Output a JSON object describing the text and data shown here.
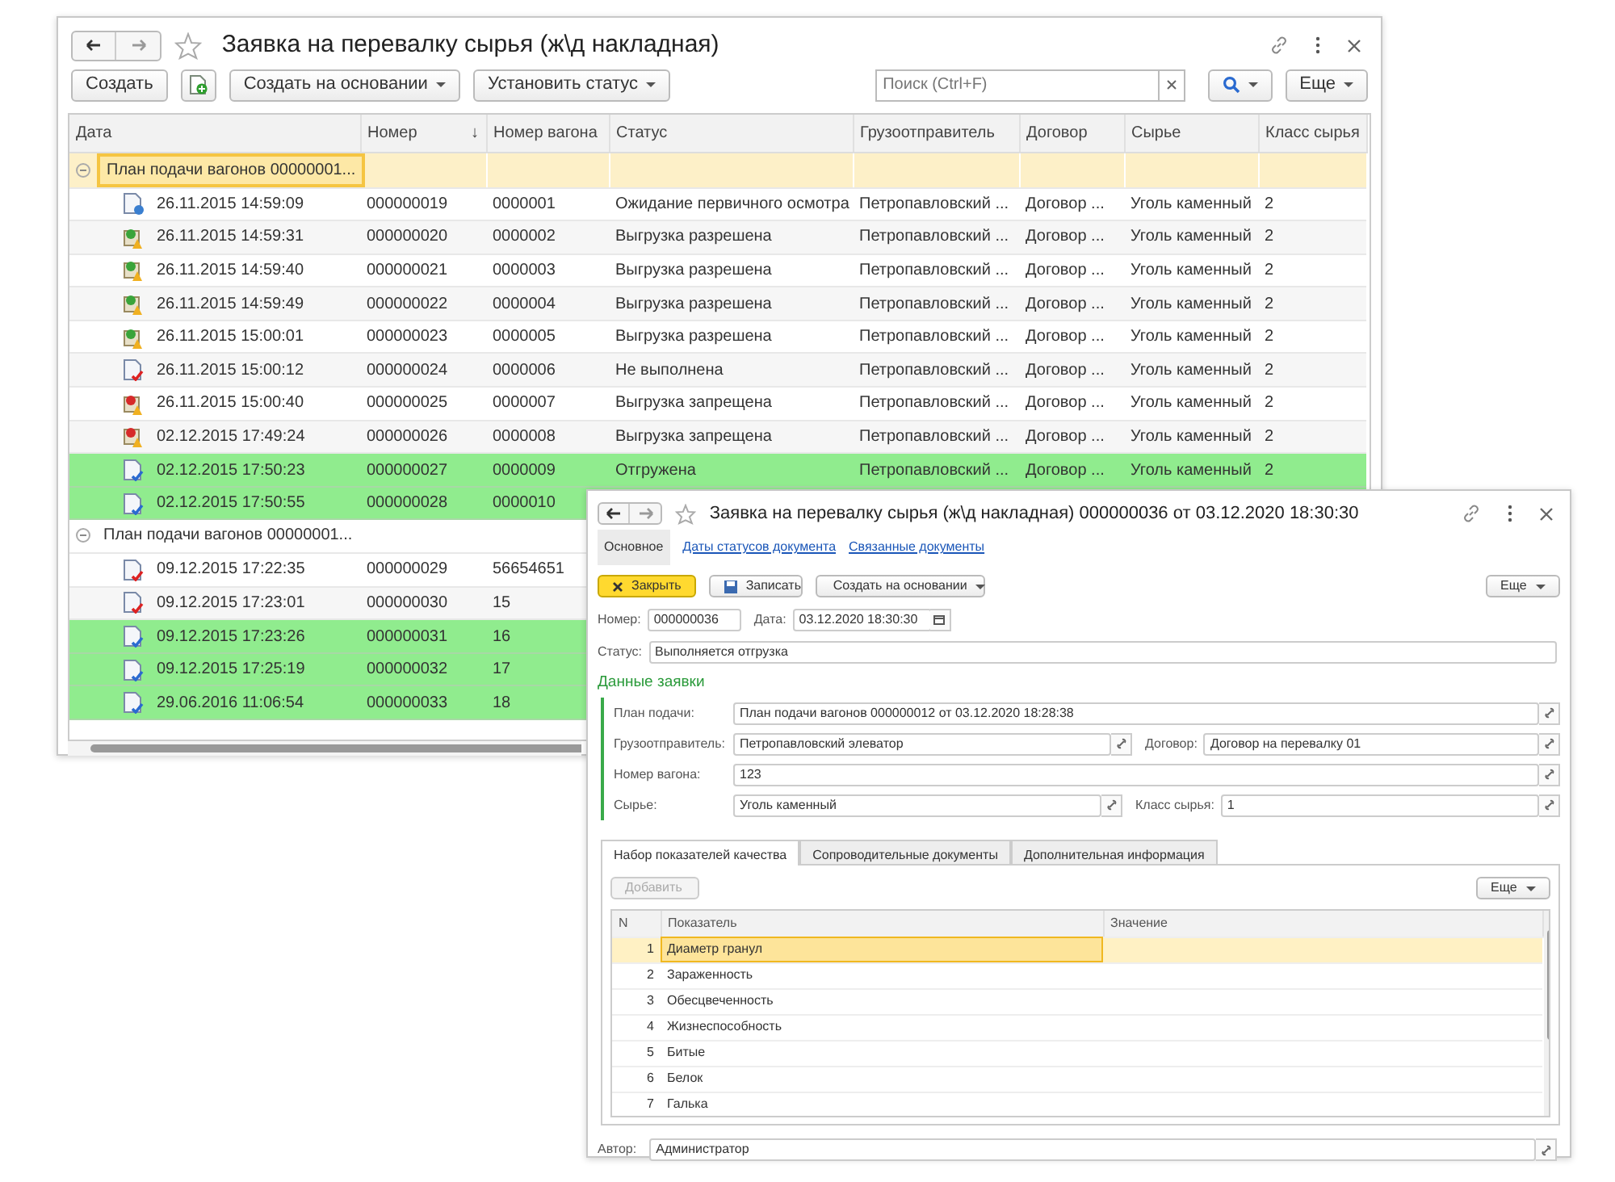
{
  "back_window": {
    "title": "Заявка на перевалку сырья (ж\\д накладная)",
    "buttons": [
      {
        "kind": "plain",
        "label": "Создать"
      },
      {
        "kind": "icon"
      },
      {
        "kind": "dropdown",
        "label": "Создать на основании"
      },
      {
        "kind": "dropdown",
        "label": "Установить статус"
      }
    ],
    "search": {
      "placeholder": "Поиск (Ctrl+F)"
    },
    "more_button": "Еще",
    "columns": [
      {
        "label": "Дата"
      },
      {
        "label": "Номер",
        "sort_arrow": "↓"
      },
      {
        "label": "Номер вагона"
      },
      {
        "label": "Статус"
      },
      {
        "label": "Грузоотправитель"
      },
      {
        "label": "Договор"
      },
      {
        "label": "Сырье"
      },
      {
        "label": "Класс сырья"
      }
    ],
    "groups": [
      {
        "label": "План подачи вагонов 00000001...",
        "selected": true,
        "expanded": true,
        "rows": [
          {
            "kind": "pending",
            "highlight": false,
            "cells": [
              "26.11.2015 14:59:09",
              "000000019",
              "0000001",
              "Ожидание первичного осмотра",
              "Петропавловский ...",
              "Договор ...",
              "Уголь каменный",
              "2"
            ]
          },
          {
            "kind": "allowed",
            "highlight": false,
            "cells": [
              "26.11.2015 14:59:31",
              "000000020",
              "0000002",
              "Выгрузка разрешена",
              "Петропавловский ...",
              "Договор ...",
              "Уголь каменный",
              "2"
            ]
          },
          {
            "kind": "allowed",
            "highlight": false,
            "cells": [
              "26.11.2015 14:59:40",
              "000000021",
              "0000003",
              "Выгрузка разрешена",
              "Петропавловский ...",
              "Договор ...",
              "Уголь каменный",
              "2"
            ]
          },
          {
            "kind": "allowed",
            "highlight": false,
            "cells": [
              "26.11.2015 14:59:49",
              "000000022",
              "0000004",
              "Выгрузка разрешена",
              "Петропавловский ...",
              "Договор ...",
              "Уголь каменный",
              "2"
            ]
          },
          {
            "kind": "allowed",
            "highlight": false,
            "cells": [
              "26.11.2015 15:00:01",
              "000000023",
              "0000005",
              "Выгрузка разрешена",
              "Петропавловский ...",
              "Договор ...",
              "Уголь каменный",
              "2"
            ]
          },
          {
            "kind": "not_done",
            "highlight": false,
            "cells": [
              "26.11.2015 15:00:12",
              "000000024",
              "0000006",
              "Не выполнена",
              "Петропавловский ...",
              "Договор ...",
              "Уголь каменный",
              "2"
            ]
          },
          {
            "kind": "forbidden",
            "highlight": false,
            "cells": [
              "26.11.2015 15:00:40",
              "000000025",
              "0000007",
              "Выгрузка запрещена",
              "Петропавловский ...",
              "Договор ...",
              "Уголь каменный",
              "2"
            ]
          },
          {
            "kind": "forbidden",
            "highlight": false,
            "cells": [
              "02.12.2015 17:49:24",
              "000000026",
              "0000008",
              "Выгрузка запрещена",
              "Петропавловский ...",
              "Договор ...",
              "Уголь каменный",
              "2"
            ]
          },
          {
            "kind": "shipped",
            "highlight": true,
            "cells": [
              "02.12.2015 17:50:23",
              "000000027",
              "0000009",
              "Отгружена",
              "Петропавловский ...",
              "Договор ...",
              "Уголь каменный",
              "2"
            ]
          },
          {
            "kind": "shipped",
            "highlight": true,
            "cells": [
              "02.12.2015 17:50:55",
              "000000028",
              "0000010"
            ]
          }
        ]
      },
      {
        "label": "План подачи вагонов 00000001...",
        "selected": false,
        "expanded": true,
        "rows": [
          {
            "kind": "not_done",
            "highlight": false,
            "cells": [
              "09.12.2015 17:22:35",
              "000000029",
              "56654651"
            ]
          },
          {
            "kind": "not_done",
            "highlight": false,
            "cells": [
              "09.12.2015 17:23:01",
              "000000030",
              "15"
            ]
          },
          {
            "kind": "shipped",
            "highlight": true,
            "cells": [
              "09.12.2015 17:23:26",
              "000000031",
              "16"
            ]
          },
          {
            "kind": "shipped",
            "highlight": true,
            "cells": [
              "09.12.2015 17:25:19",
              "000000032",
              "17"
            ]
          },
          {
            "kind": "shipped",
            "highlight": true,
            "cells": [
              "29.06.2016 11:06:54",
              "000000033",
              "18"
            ]
          }
        ]
      }
    ]
  },
  "front_window": {
    "title": "Заявка на перевалку сырья (ж\\д накладная) 000000036 от 03.12.2020 18:30:30",
    "nav": [
      {
        "label": "Основное",
        "selected": true
      },
      {
        "label": "Даты статусов документа",
        "selected": false
      },
      {
        "label": "Связанные документы",
        "selected": false
      }
    ],
    "buttons": [
      {
        "kind": "primary",
        "label": "Закрыть"
      },
      {
        "kind": "save",
        "label": "Записать"
      },
      {
        "kind": "dropdown",
        "label": "Создать на основании"
      }
    ],
    "more_button": "Еще",
    "number": {
      "label": "Номер:",
      "value": "000000036"
    },
    "date": {
      "label": "Дата:",
      "value": "03.12.2020 18:30:30"
    },
    "status": {
      "label": "Статус:",
      "value": "Выполняется отгрузка"
    },
    "section_title": "Данные заявки",
    "field_rows": [
      [
        {
          "label": "План подачи:",
          "value": "План подачи вагонов 000000012 от 03.12.2020 18:28:38"
        }
      ],
      [
        {
          "label": "Грузоотправитель:",
          "value": "Петропавловский элеватор"
        },
        {
          "label": "Договор:",
          "value": "Договор на перевалку 01"
        }
      ],
      [
        {
          "label": "Номер вагона:",
          "value": "123"
        }
      ],
      [
        {
          "label": "Сырье:",
          "value": "Уголь каменный"
        },
        {
          "label": "Класс сырья:",
          "value": "1"
        }
      ]
    ],
    "tabs": [
      {
        "label": "Набор показателей качества",
        "selected": true
      },
      {
        "label": "Сопроводительные документы",
        "selected": false
      },
      {
        "label": "Дополнительная информация",
        "selected": false
      }
    ],
    "add_button": {
      "label": "Добавить",
      "disabled": true
    },
    "table_more_button": "Еще",
    "table_columns": [
      "N",
      "Показатель",
      "Значение"
    ],
    "table_rows": [
      {
        "n": "1",
        "name": "Диаметр гранул",
        "selected": true
      },
      {
        "n": "2",
        "name": "Зараженность",
        "selected": false
      },
      {
        "n": "3",
        "name": "Обесцвеченность",
        "selected": false
      },
      {
        "n": "4",
        "name": "Жизнеспособность",
        "selected": false
      },
      {
        "n": "5",
        "name": "Битые",
        "selected": false
      },
      {
        "n": "6",
        "name": "Белок",
        "selected": false
      },
      {
        "n": "7",
        "name": "Галька",
        "selected": false
      }
    ],
    "author": {
      "label": "Автор:",
      "value": "Администратор"
    }
  }
}
